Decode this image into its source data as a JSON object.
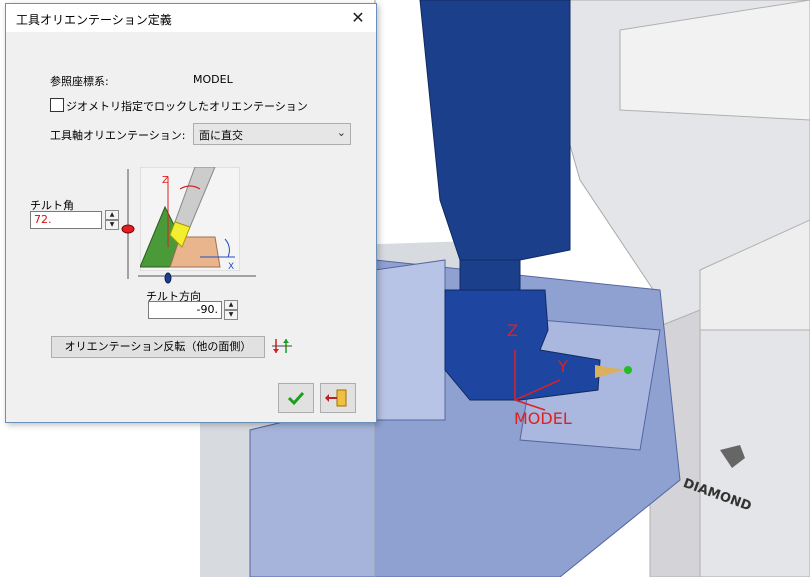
{
  "dialog": {
    "title": "工具オリエンテーション定義",
    "ref_label": "参照座標系:",
    "ref_value": "MODEL",
    "lock_checkbox_label": "ジオメトリ指定でロックしたオリエンテーション",
    "tool_axis_label": "工具軸オリエンテーション:",
    "tool_axis_value": "面に直交",
    "tilt_angle_label": "チルト角",
    "tilt_angle_value": "72.",
    "tilt_dir_label": "チルト方向",
    "tilt_dir_value": "-90.",
    "flip_button_label": "オリエンテーション反転（他の面側）"
  },
  "diagram": {
    "z_label": "Z",
    "x_label": "X"
  },
  "scene": {
    "axis_z": "Z",
    "axis_y": "Y",
    "axis_label": "MODEL",
    "brand": "DIAMOND"
  },
  "colors": {
    "accent_red": "#e02020",
    "ok_green": "#1ca01c",
    "machine_blue": "#1c3f8c"
  }
}
